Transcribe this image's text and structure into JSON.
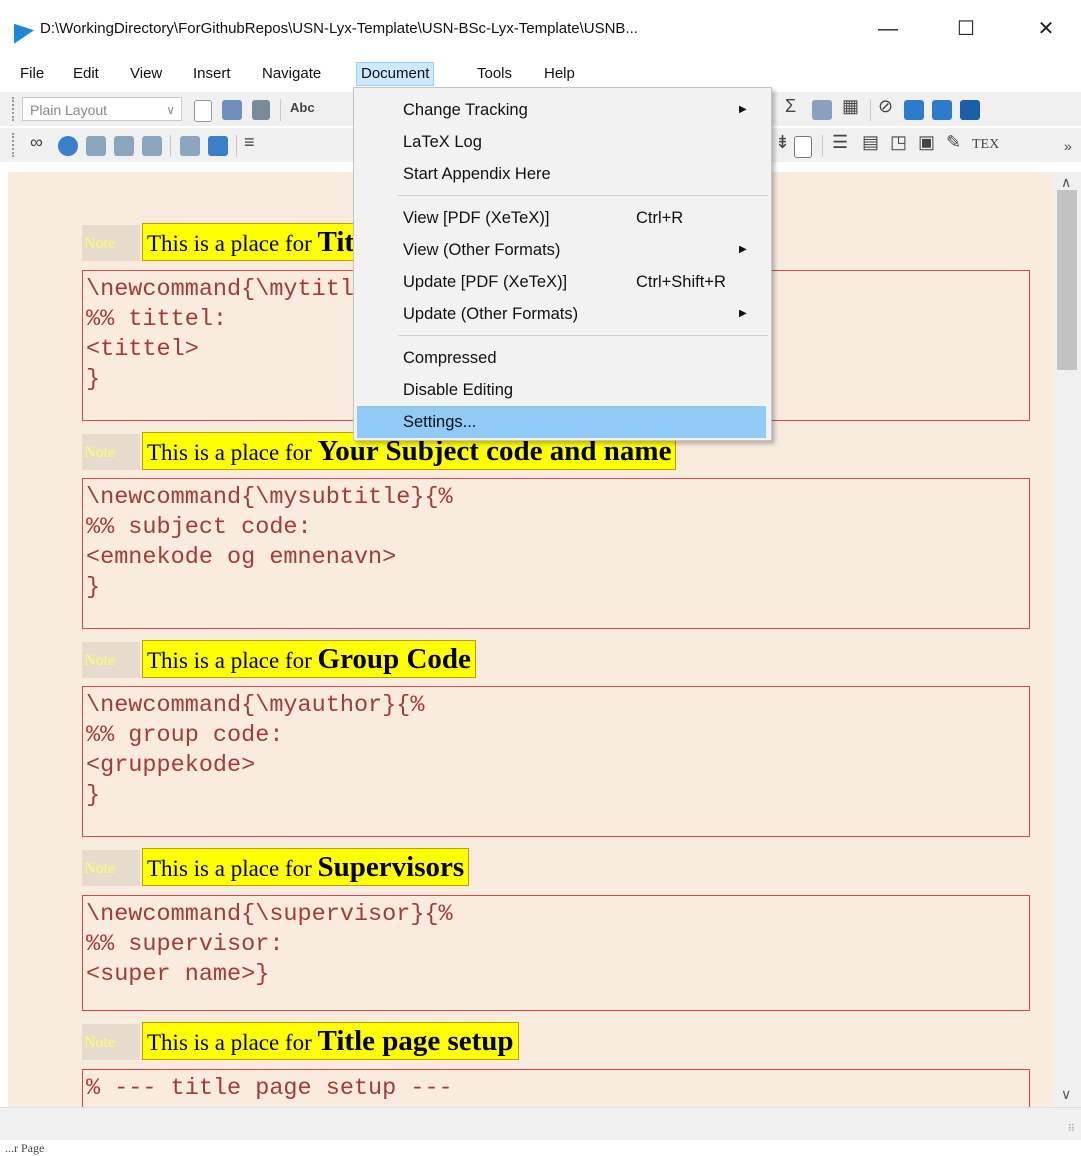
{
  "window": {
    "title": "D:\\WorkingDirectory\\ForGithubRepos\\USN-Lyx-Template\\USN-BSc-Lyx-Template\\USNB...",
    "minimize": "—",
    "maximize": "☐",
    "close": "✕"
  },
  "menubar": {
    "items": [
      "File",
      "Edit",
      "View",
      "Insert",
      "Navigate",
      "Document",
      "Tools",
      "Help"
    ],
    "active": "Document"
  },
  "toolbar": {
    "layout_value": "Plain Layout",
    "overflow": "»",
    "tex_label": "TEX"
  },
  "dropdown": {
    "items": [
      {
        "label": "Change Tracking",
        "shortcut": "",
        "submenu": true
      },
      {
        "label": "LaTeX Log",
        "shortcut": "",
        "submenu": false
      },
      {
        "label": "Start Appendix Here",
        "shortcut": "",
        "submenu": false
      },
      {
        "label": "View [PDF (XeTeX)]",
        "shortcut": "Ctrl+R",
        "submenu": false
      },
      {
        "label": "View (Other Formats)",
        "shortcut": "",
        "submenu": true
      },
      {
        "label": "Update [PDF (XeTeX)]",
        "shortcut": "Ctrl+Shift+R",
        "submenu": false
      },
      {
        "label": "Update (Other Formats)",
        "shortcut": "",
        "submenu": true
      },
      {
        "label": "Compressed",
        "shortcut": "",
        "submenu": false
      },
      {
        "label": "Disable Editing",
        "shortcut": "",
        "submenu": false
      },
      {
        "label": "Settings...",
        "shortcut": "",
        "submenu": false
      }
    ],
    "highlighted": "Settings..."
  },
  "document": {
    "note_tag": "Note",
    "note_prefix": "This is a place for",
    "sections": [
      {
        "note_bold": "Title",
        "lines": [
          "\\newcommand{\\mytitle}{%",
          "%% tittel:",
          "<tittel>",
          "}"
        ]
      },
      {
        "note_bold": "Your Subject code and name",
        "lines": [
          "\\newcommand{\\mysubtitle}{%",
          "%% subject code:",
          "<emnekode og emnenavn>",
          "}"
        ]
      },
      {
        "note_bold": "Group Code",
        "lines": [
          "\\newcommand{\\myauthor}{%",
          "%% group code:",
          "<gruppekode>",
          "}"
        ]
      },
      {
        "note_bold": "Supervisors",
        "lines": [
          "\\newcommand{\\supervisor}{%",
          "%% supervisor:",
          "<super name>}"
        ]
      },
      {
        "note_bold": "Title page setup",
        "lines": [
          "% --- title page setup ---"
        ]
      }
    ]
  },
  "taskbar": {
    "text": "...r Page"
  },
  "colors": {
    "doc_background": "#faebdf",
    "note_highlight": "#ffff00",
    "ert_border": "#d8484a",
    "ert_text": "#a33b36",
    "menu_highlight": "#91c9f7"
  }
}
